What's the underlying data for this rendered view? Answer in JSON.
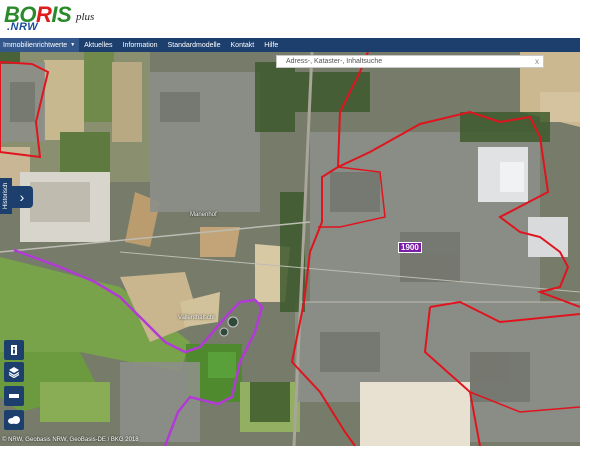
{
  "logo": {
    "brand_b": "BO",
    "brand_r": "R",
    "brand_rest": "IS",
    "plus": "plus",
    "nrw": ".NRW"
  },
  "nav": {
    "dropdown_label": "Immobilienrichtwerte",
    "items": [
      "Aktuelles",
      "Information",
      "Standardmodelle",
      "Kontakt",
      "Hilfe"
    ]
  },
  "search": {
    "placeholder": "Adress-, Kataster-, Inhaltsuche",
    "clear": "x"
  },
  "map": {
    "zone_label": "1900",
    "place_labels": [
      "Manenhof",
      "Vallenthalschl"
    ],
    "copyright": "© NRW, Geobasis NRW, GeoBasis-DE / BKG 2018"
  },
  "side": {
    "historisch_tab": "Historisch",
    "expand_arrow": "›"
  },
  "colors": {
    "nav_bg": "#1c3f6e",
    "zone_border": "#e0141e",
    "route": "#b23ad6",
    "zone_badge": "#7a1ea8"
  },
  "icons": [
    "info-icon",
    "layers-icon",
    "measure-icon",
    "cloud-icon"
  ]
}
